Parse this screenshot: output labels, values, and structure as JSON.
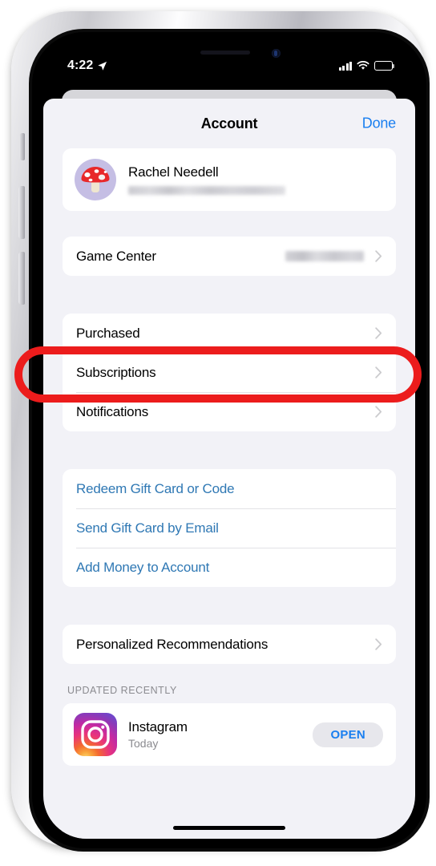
{
  "status_bar": {
    "time": "4:22",
    "location_icon": "location-arrow-icon",
    "cellular_icon": "cellular-bars-icon",
    "wifi_icon": "wifi-icon",
    "battery_icon": "battery-icon",
    "battery_fill_percent": 52
  },
  "sheet": {
    "title": "Account",
    "done_label": "Done"
  },
  "profile": {
    "name": "Rachel Needell",
    "email_redacted": "",
    "avatar_icon": "mushroom-avatar-icon"
  },
  "game_center": {
    "label": "Game Center",
    "value_redacted": "",
    "chevron_icon": "chevron-right-icon"
  },
  "settings_rows": [
    {
      "label": "Purchased",
      "chevron_icon": "chevron-right-icon",
      "highlighted": true
    },
    {
      "label": "Subscriptions",
      "chevron_icon": "chevron-right-icon",
      "highlighted": false
    },
    {
      "label": "Notifications",
      "chevron_icon": "chevron-right-icon",
      "highlighted": false
    }
  ],
  "gift_links": [
    {
      "label": "Redeem Gift Card or Code"
    },
    {
      "label": "Send Gift Card by Email"
    },
    {
      "label": "Add Money to Account"
    }
  ],
  "recommendations": {
    "label": "Personalized Recommendations",
    "chevron_icon": "chevron-right-icon"
  },
  "updated_section": {
    "header": "UPDATED RECENTLY",
    "app": {
      "name": "Instagram",
      "subtitle": "Today",
      "action_label": "OPEN",
      "icon": "instagram-app-icon"
    }
  },
  "annotation": {
    "shape": "rounded-rectangle-outline",
    "color": "#ec1c1c",
    "targets": "Purchased"
  },
  "colors": {
    "accent_blue": "#1a7ff0",
    "link_blue": "#2f78b4",
    "sheet_background": "#f2f2f7",
    "card_background": "#ffffff",
    "annotation_red": "#ec1c1c"
  }
}
